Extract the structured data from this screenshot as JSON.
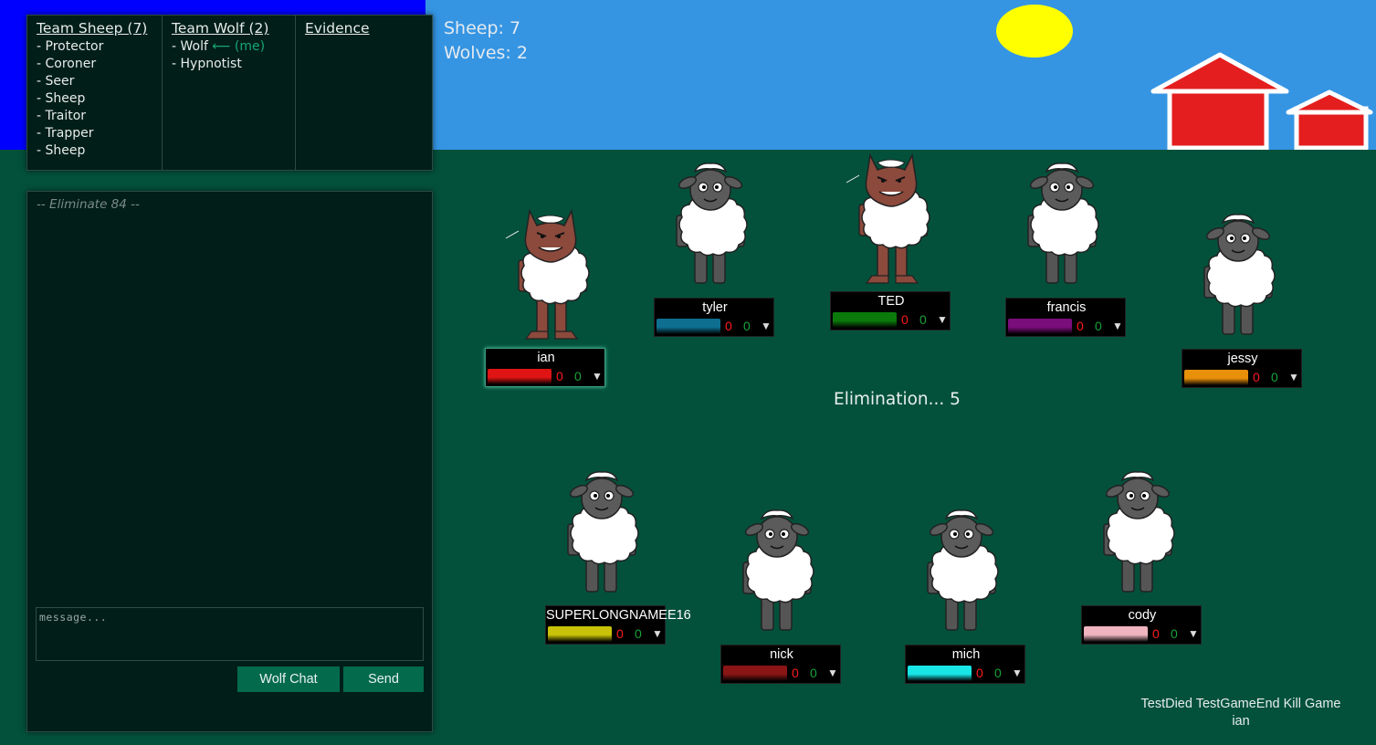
{
  "teams": {
    "sheep": {
      "title": "Team Sheep (7)",
      "items": [
        "- Protector",
        "- Coroner",
        "- Seer",
        "- Sheep",
        "- Traitor",
        "- Trapper",
        "- Sheep"
      ]
    },
    "wolf": {
      "title": "Team Wolf (2)",
      "items": [
        {
          "text": "- Wolf",
          "tag": "⟵ (me)"
        },
        {
          "text": "- Hypnotist",
          "tag": ""
        }
      ]
    },
    "evidence": {
      "title": "Evidence"
    }
  },
  "chat": {
    "log": [
      "-- Eliminate 84 --"
    ],
    "placeholder": "message...",
    "wolf_chat_label": "Wolf Chat",
    "send_label": "Send"
  },
  "counts": {
    "sheep": "Sheep: 7",
    "wolves": "Wolves: 2"
  },
  "phase": "Elimination... 5",
  "players": [
    {
      "name": "ian",
      "type": "wolf",
      "color": "#e01414",
      "red": "0",
      "green": "0",
      "selected": true
    },
    {
      "name": "tyler",
      "type": "sheep",
      "color": "#0e6f91",
      "red": "0",
      "green": "0",
      "selected": false
    },
    {
      "name": "TED",
      "type": "wolf",
      "color": "#0b7a0b",
      "red": "0",
      "green": "0",
      "selected": false
    },
    {
      "name": "francis",
      "type": "sheep",
      "color": "#7a0e7a",
      "red": "0",
      "green": "0",
      "selected": false
    },
    {
      "name": "jessy",
      "type": "sheep",
      "color": "#e8900a",
      "red": "0",
      "green": "0",
      "selected": false
    },
    {
      "name": "SUPERLONGNAMEE16",
      "type": "sheep",
      "color": "#c9c208",
      "red": "0",
      "green": "0",
      "selected": false
    },
    {
      "name": "nick",
      "type": "sheep",
      "color": "#8a1515",
      "red": "0",
      "green": "0",
      "selected": false
    },
    {
      "name": "mich",
      "type": "sheep",
      "color": "#18e6e6",
      "red": "0",
      "green": "0",
      "selected": false
    },
    {
      "name": "cody",
      "type": "sheep",
      "color": "#f0b5c0",
      "red": "0",
      "green": "0",
      "selected": false
    }
  ],
  "dropdown_glyph": "▼",
  "debug": {
    "test_died": "TestDied",
    "test_game_end": "TestGameEnd",
    "kill_game": "Kill Game",
    "user": "ian"
  },
  "colors": {
    "sky": "#3595e3",
    "grass": "#03513b",
    "panel": "#011e19",
    "button": "#046a4c",
    "sun": "#ffff00",
    "barn": "#e41e1e"
  }
}
